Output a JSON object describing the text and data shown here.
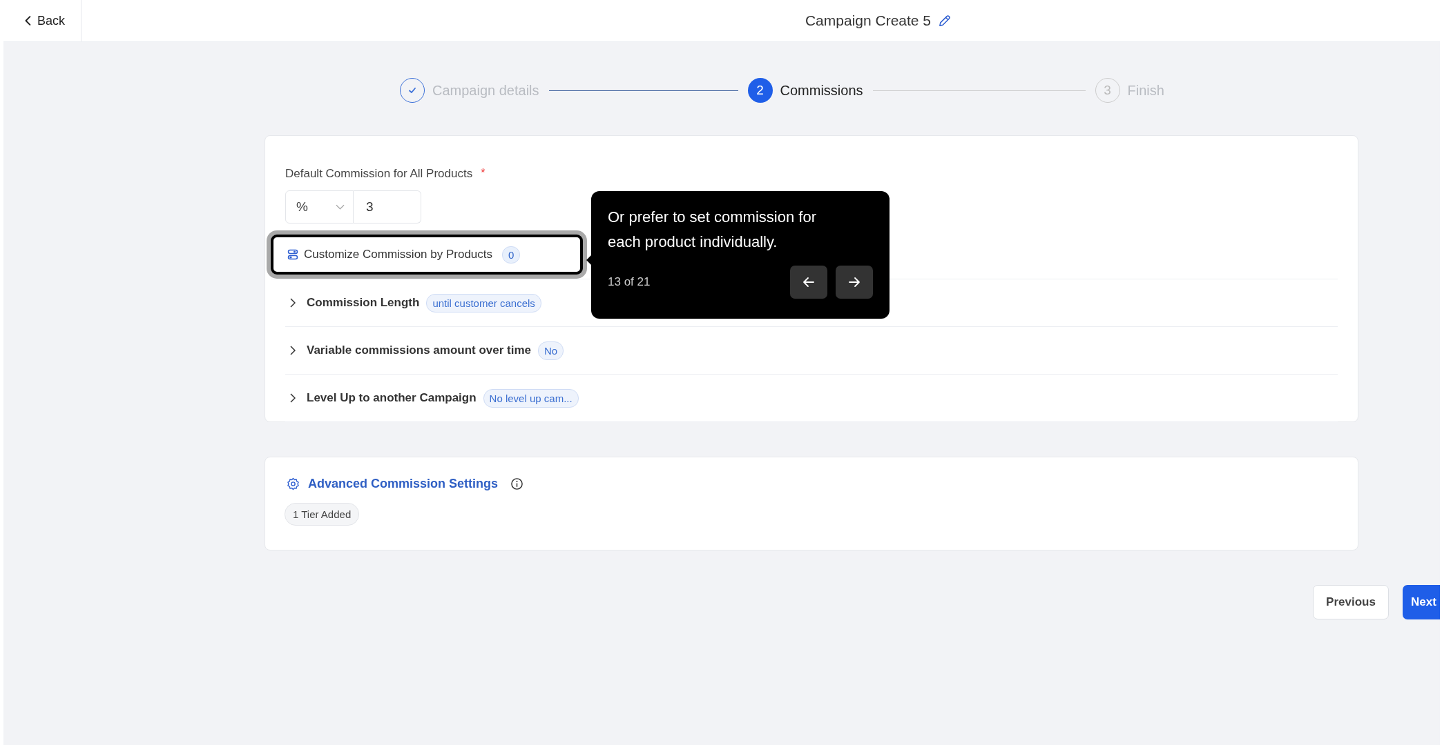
{
  "header": {
    "back_label": "Back",
    "title": "Campaign Create 5"
  },
  "steps": [
    {
      "label": "Campaign details",
      "completed": true,
      "selected": false
    },
    {
      "number": "2",
      "label": "Commissions",
      "completed": false,
      "selected": true
    },
    {
      "number": "3",
      "label": "Finish",
      "completed": false,
      "selected": false
    }
  ],
  "commission": {
    "label": "Default Commission for All Products",
    "required_mark": "*",
    "type_value": "%",
    "amount_value": "3"
  },
  "customize": {
    "label": "Customize Commission by Products",
    "count": "0",
    "highlighted": true
  },
  "sections": [
    {
      "label": "Commission Length",
      "tag": "until customer cancels",
      "expanded": false
    },
    {
      "label": "Variable commissions amount over time",
      "tag": "No",
      "expanded": false
    },
    {
      "label": "Level Up to another Campaign",
      "tag": "No level up cam...",
      "expanded": false
    }
  ],
  "advanced": {
    "title": "Advanced Commission Settings",
    "tier_badge": "1 Tier Added"
  },
  "tour": {
    "text": "Or prefer to set commission for each product individually.",
    "step_count": "13 of 21"
  },
  "footer": {
    "buttons": [
      {
        "label": "Previous",
        "kind": "secondary"
      },
      {
        "label": "Next",
        "kind": "primary"
      }
    ]
  }
}
